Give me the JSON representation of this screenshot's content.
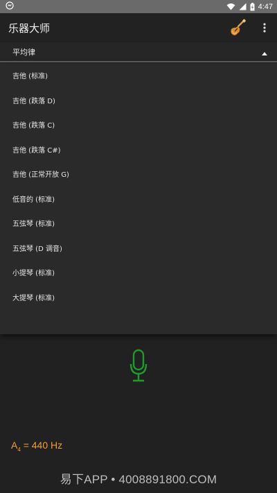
{
  "status_bar": {
    "time": "4:47",
    "notification_icon": "app-notification-icon",
    "wifi_icon": "wifi-icon",
    "signal_icon": "cell-signal-icon",
    "battery_icon": "battery-charging-icon"
  },
  "app_bar": {
    "title": "乐器大师",
    "instrument_icon": "electric-guitar-icon",
    "menu_icon": "overflow-menu-icon"
  },
  "temperament": {
    "selected": "平均律",
    "arrow_icon": "triangle-up-icon"
  },
  "tunings": [
    "吉他 (标准)",
    "吉他 (跌落 D)",
    "吉他 (跌落 C)",
    "吉他 (跌落 C#)",
    "吉他 (正常开放 G)",
    "低音的 (标准)",
    "五弦琴 (标准)",
    "五弦琴 (D 调音)",
    "小提琴 (标准)",
    "大提琴 (标准)"
  ],
  "tuner": {
    "mic_icon": "microphone-icon",
    "mic_color": "#1e9b2a",
    "reference_note": "A",
    "reference_octave": "4",
    "reference_value": "= 440 Hz",
    "accent_color": "#f0a030"
  },
  "watermark": "易下APP • 4008891800.COM"
}
